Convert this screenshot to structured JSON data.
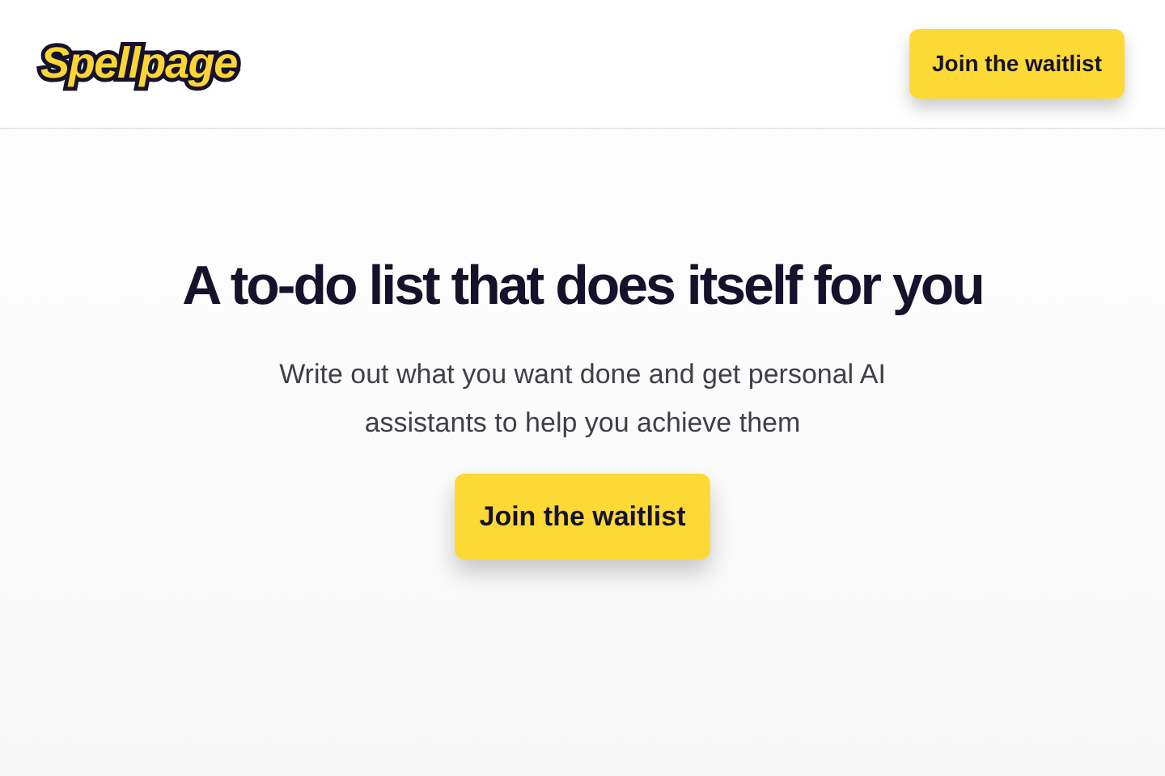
{
  "header": {
    "logo": "Spellpage",
    "button": "Join the waitlist"
  },
  "hero": {
    "title": "A to-do list that does itself for you",
    "subtitle": "Write out what you want done and get personal AI assistants to help you achieve them",
    "button": "Join the waitlist"
  }
}
